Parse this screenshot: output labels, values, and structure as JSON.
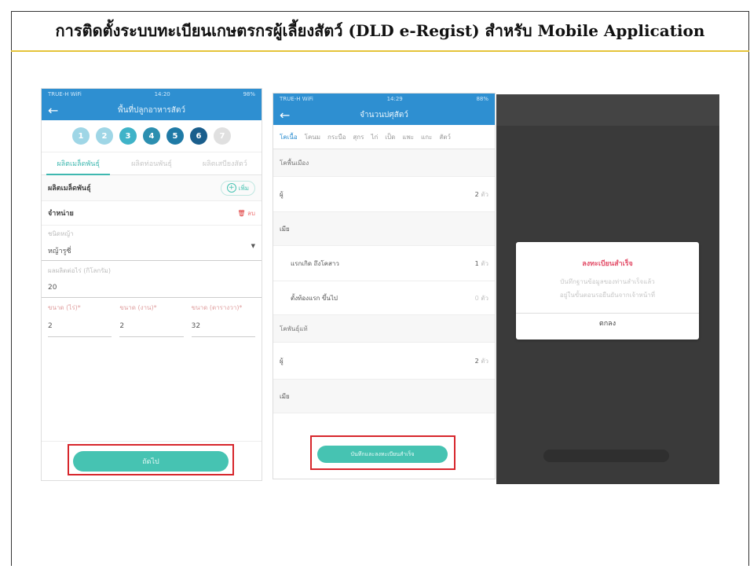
{
  "document": {
    "title": "การติดตั้งระบบทะเบียนเกษตรกรผู้เลี้ยงสัตว์ (DLD e-Regist) สำหรับ Mobile Application"
  },
  "colors": {
    "accent": "#2e8fd1",
    "teal": "#46c3b2",
    "highlight_border": "#d7262c",
    "title_rule": "#e5c43a"
  },
  "screen1": {
    "status_left": "TRUE-H WiFi",
    "status_time": "14:20",
    "status_right": "98%",
    "back_icon": "arrow-left-icon",
    "app_title": "พื้นที่ปลูกอาหารสัตว์",
    "steps": [
      "1",
      "2",
      "3",
      "4",
      "5",
      "6",
      "7"
    ],
    "tabs": [
      "ผลิตเมล็ดพันธุ์",
      "ผลิตท่อนพันธุ์",
      "ผลิตเสบียงสัตว์"
    ],
    "section_title": "ผลิตเมล็ดพันธุ์",
    "add_label": "เพิ่ม",
    "item_title": "จำหน่าย",
    "delete_label": "ลบ",
    "grass_type_label": "ชนิดหญ้า",
    "grass_type_value": "หญ้ารูซี่",
    "yield_label": "ผลผลิตต่อไร่ (กิโลกรัม)",
    "yield_value": "20",
    "size_labels": [
      "ขนาด (ไร่)*",
      "ขนาด (งาน)*",
      "ขนาด (ตารางวา)*"
    ],
    "size_values": [
      "2",
      "2",
      "32"
    ],
    "save_button": "ถัดไป"
  },
  "screen2": {
    "status_left": "TRUE-H WiFi",
    "status_time": "14:29",
    "status_right": "88%",
    "app_title": "จำนวนปศุสัตว์",
    "categories": [
      "โคเนื้อ",
      "โคนม",
      "กระบือ",
      "สุกร",
      "ไก่",
      "เป็ด",
      "แพะ",
      "แกะ",
      "สัตว์"
    ],
    "group1_title": "โคพื้นเมือง",
    "group1_rows": [
      {
        "label": "ผู้",
        "value": "2",
        "unit": "ตัว",
        "indent": false
      },
      {
        "label": "เมีย",
        "value": "",
        "unit": "",
        "indent": false
      },
      {
        "label": "แรกเกิด ถึงโคสาว",
        "value": "1",
        "unit": "ตัว",
        "indent": true
      },
      {
        "label": "ตั้งท้องแรก ขึ้นไป",
        "value": "0",
        "unit": "ตัว",
        "indent": true
      }
    ],
    "group2_title": "โคพันธุ์แท้",
    "group2_rows": [
      {
        "label": "ผู้",
        "value": "2",
        "unit": "ตัว",
        "indent": false
      },
      {
        "label": "เมีย",
        "value": "",
        "unit": "",
        "indent": false
      }
    ],
    "save_button": "บันทึกและลงทะเบียนสำเร็จ"
  },
  "screen3": {
    "dialog_title": "ลงทะเบียนสำเร็จ",
    "dialog_message_line1": "บันทึกฐานข้อมูลของท่านสำเร็จแล้ว",
    "dialog_message_line2": "อยู่ในขั้นตอนรอยืนยันจากเจ้าหน้าที่",
    "ok_button": "ตกลง"
  }
}
